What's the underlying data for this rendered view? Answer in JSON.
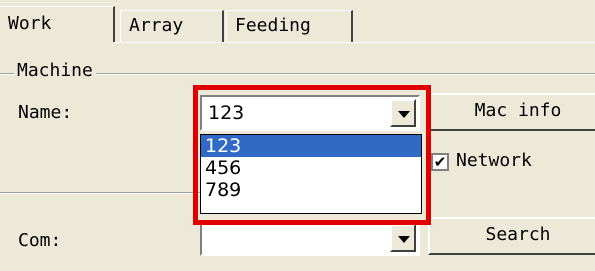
{
  "tabs": [
    {
      "label": "Work",
      "active": true
    },
    {
      "label": "Array",
      "active": false
    },
    {
      "label": "Feeding",
      "active": false
    }
  ],
  "group": {
    "label": "Machine"
  },
  "name": {
    "label": "Name:",
    "value": "123",
    "options": [
      "123",
      "456",
      "789"
    ],
    "selected_option": "123"
  },
  "buttons": {
    "mac_info": "Mac info",
    "search": "Search"
  },
  "network": {
    "label": "Network",
    "checked": true,
    "check_glyph": "✔"
  },
  "com": {
    "label": "Com:",
    "value": ""
  },
  "colors": {
    "highlight": "#e00000",
    "selection": "#316ac5",
    "background": "#ece9d8"
  }
}
